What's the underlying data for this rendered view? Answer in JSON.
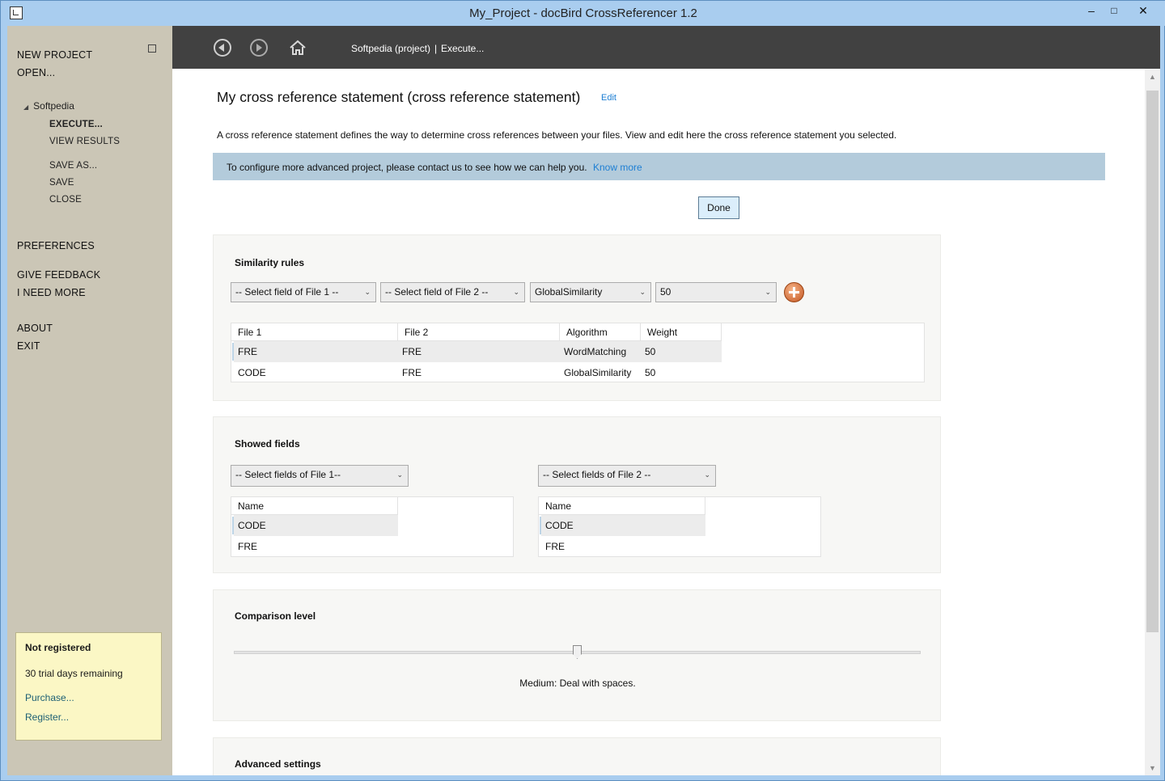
{
  "window": {
    "title": "My_Project - docBird CrossReferencer 1.2",
    "controls": [
      "–",
      "□",
      "✕"
    ]
  },
  "sidebar": {
    "main_items": [
      "NEW PROJECT",
      "OPEN..."
    ],
    "tree_node": "Softpedia",
    "project_items": [
      "EXECUTE...",
      "VIEW RESULTS"
    ],
    "file_items": [
      "SAVE AS...",
      "SAVE",
      "CLOSE"
    ],
    "preferences": "PREFERENCES",
    "feedback_items": [
      "GIVE FEEDBACK",
      "I NEED MORE"
    ],
    "app_items": [
      "ABOUT",
      "EXIT"
    ],
    "registration": {
      "title": "Not registered",
      "remaining": "30 trial days remaining",
      "purchase": "Purchase...",
      "register": "Register..."
    }
  },
  "toolbar": {
    "icons": [
      "back-icon",
      "forward-icon",
      "home-icon"
    ],
    "breadcrumb_project": "Softpedia (project)",
    "breadcrumb_sep": "|",
    "breadcrumb_page": "Execute..."
  },
  "main": {
    "title": "My cross reference statement (cross reference statement)",
    "edit_link": "Edit",
    "description": "A cross reference statement defines the way to determine cross references between your files. View and edit here the cross reference statement you selected.",
    "banner_text": "To configure more advanced project, please contact us to see how we can help you.",
    "banner_link": "Know more",
    "done_button": "Done"
  },
  "similarity": {
    "title": "Similarity rules",
    "selects": [
      "-- Select field of File 1 --",
      "-- Select field of File 2 --",
      "GlobalSimilarity",
      "50"
    ],
    "columns": [
      "File 1",
      "File 2",
      "Algorithm",
      "Weight"
    ],
    "rows": [
      [
        "FRE",
        "FRE",
        "WordMatching",
        "50"
      ],
      [
        "CODE",
        "FRE",
        "GlobalSimilarity",
        "50"
      ]
    ]
  },
  "showed_fields": {
    "title": "Showed fields",
    "select_file1": "-- Select fields of File 1--",
    "select_file2": "-- Select fields of File 2 --",
    "column": "Name",
    "file1_rows": [
      "CODE",
      "FRE"
    ],
    "file2_rows": [
      "CODE",
      "FRE"
    ]
  },
  "comparison": {
    "title": "Comparison level",
    "level": 0.5,
    "caption": "Medium: Deal with spaces."
  },
  "advanced": {
    "title": "Advanced settings"
  }
}
